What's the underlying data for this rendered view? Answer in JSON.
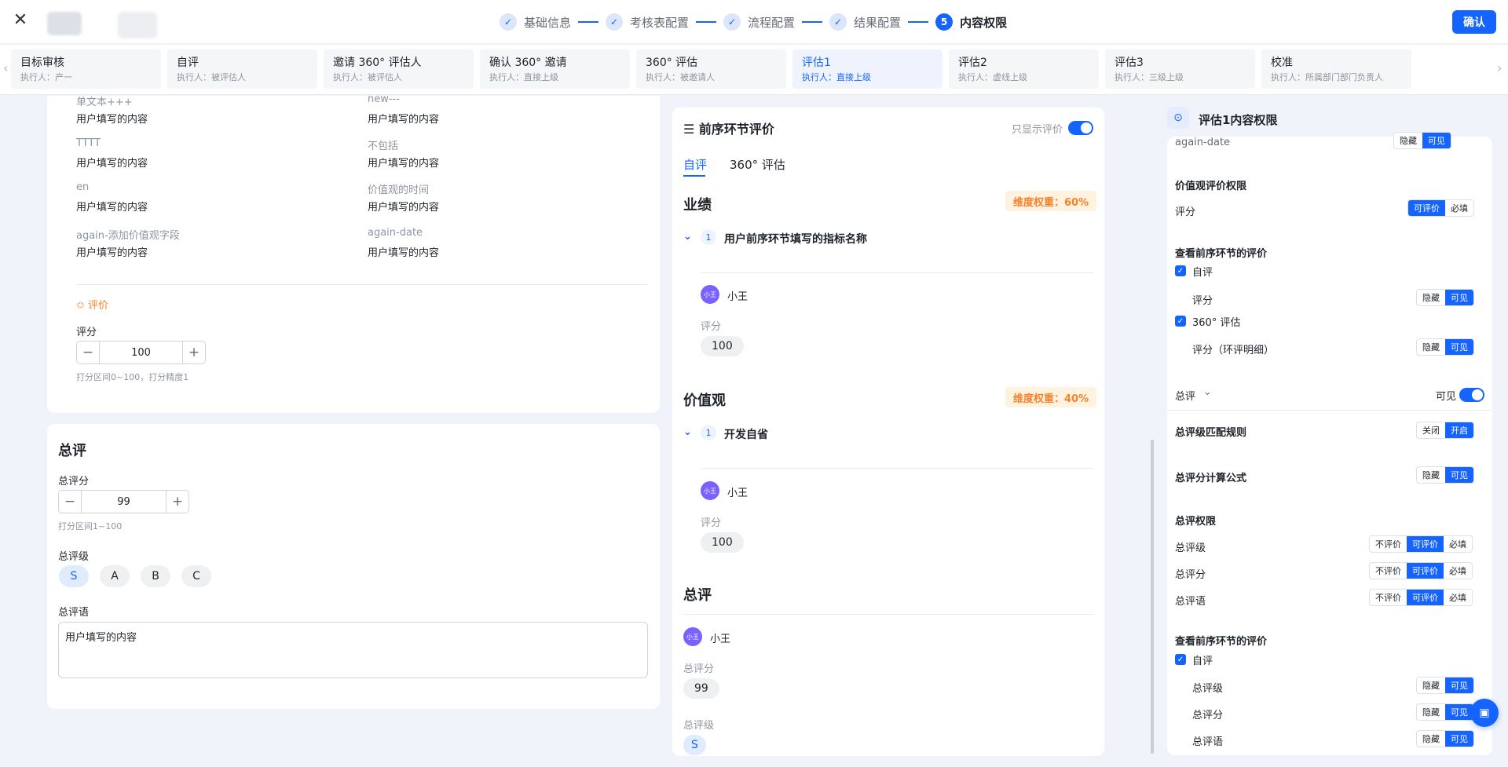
{
  "header": {
    "steps": [
      {
        "label": "基础信息",
        "state": "done"
      },
      {
        "label": "考核表配置",
        "state": "done"
      },
      {
        "label": "流程配置",
        "state": "done"
      },
      {
        "label": "结果配置",
        "state": "done"
      },
      {
        "label": "内容权限",
        "number": "5",
        "state": "current"
      }
    ],
    "confirm_label": "确认",
    "accent_color": "#1664ff"
  },
  "tabs": [
    {
      "title": "目标审核",
      "sub": "执行人：产一"
    },
    {
      "title": "自评",
      "sub": "执行人：被评估人"
    },
    {
      "title": "邀请 360° 评估人",
      "sub": "执行人：被评估人"
    },
    {
      "title": "确认 360° 邀请",
      "sub": "执行人：直接上级"
    },
    {
      "title": "360° 评估",
      "sub": "执行人：被邀请人"
    },
    {
      "title": "评估1",
      "sub": "执行人：直接上级",
      "active": true
    },
    {
      "title": "评估2",
      "sub": "执行人：虚线上级"
    },
    {
      "title": "评估3",
      "sub": "执行人：三级上级"
    },
    {
      "title": "校准",
      "sub": "执行人：所属部门部门负责人"
    }
  ],
  "left": {
    "fields": [
      {
        "label": "单文本+++",
        "value": "用户填写的内容"
      },
      {
        "label": "new---",
        "value": "用户填写的内容"
      },
      {
        "label": "TTTT",
        "value": "用户填写的内容"
      },
      {
        "label": "不包括",
        "value": "用户填写的内容"
      },
      {
        "label": "en",
        "value": "用户填写的内容"
      },
      {
        "label": "价值观的时间",
        "value": "用户填写的内容"
      },
      {
        "label": "again-添加价值观字段",
        "value": "用户填写的内容"
      },
      {
        "label": "again-date",
        "value": "用户填写的内容"
      }
    ],
    "eval_section": "评价",
    "score_label": "评分",
    "score_value": "100",
    "score_hint": "打分区间0~100，打分精度1",
    "overall": {
      "title": "总评",
      "total_score_label": "总评分",
      "total_score_value": "99",
      "total_score_hint": "打分区间1~100",
      "grade_label": "总评级",
      "grades": [
        "S",
        "A",
        "B",
        "C"
      ],
      "selected_grade": "S",
      "comment_label": "总评语",
      "comment_value": "用户填写的内容"
    }
  },
  "middle": {
    "title": "前序环节评价",
    "toggle_label": "只显示评价",
    "toggle_on": true,
    "tabs": [
      "自评",
      "360° 评估"
    ],
    "active_tab": "自评",
    "sections": [
      {
        "name": "业绩",
        "weight": "维度权重：60%",
        "item_num": "1",
        "item_name": "用户前序环节填写的指标名称",
        "user": "小王",
        "avatar_text": "小王",
        "score_label": "评分",
        "score": "100"
      },
      {
        "name": "价值观",
        "weight": "维度权重：40%",
        "item_num": "1",
        "item_name": "开发自省",
        "user": "小王",
        "avatar_text": "小王",
        "score_label": "评分",
        "score": "100"
      }
    ],
    "summary": {
      "title": "总评",
      "user": "小王",
      "avatar_text": "小王",
      "total_score_label": "总评分",
      "total_score": "99",
      "grade_label": "总评级",
      "grade": "S"
    }
  },
  "right": {
    "title": "评估1内容权限",
    "cut_row": {
      "label": "again-date",
      "opts": [
        "隐藏",
        "可见"
      ]
    },
    "values_perm": {
      "title": "价值观评价权限",
      "row_label": "评分",
      "opts": [
        "可评价",
        "必填"
      ]
    },
    "prev_view": {
      "title": "查看前序环节的评价",
      "items": [
        {
          "check": "自评",
          "row_label": "评分",
          "opts": [
            "隐藏",
            "可见"
          ]
        },
        {
          "check": "360° 评估",
          "row_label": "评分（环评明细）",
          "opts": [
            "隐藏",
            "可见"
          ]
        }
      ]
    },
    "overall": {
      "label": "总评",
      "visible_label": "可见",
      "visible_on": true,
      "match_rule": {
        "label": "总评级匹配规则",
        "opts": [
          "关闭",
          "开启"
        ]
      },
      "formula": {
        "label": "总评分计算公式",
        "opts": [
          "隐藏",
          "可见"
        ]
      },
      "perm_title": "总评权限",
      "perm_rows": [
        {
          "label": "总评级",
          "opts": [
            "不评价",
            "可评价",
            "必填"
          ]
        },
        {
          "label": "总评分",
          "opts": [
            "不评价",
            "可评价",
            "必填"
          ]
        },
        {
          "label": "总评语",
          "opts": [
            "不评价",
            "可评价",
            "必填"
          ]
        }
      ],
      "prev_title": "查看前序环节的评价",
      "prev_check": "自评",
      "prev_rows": [
        {
          "label": "总评级",
          "opts": [
            "隐藏",
            "可见"
          ]
        },
        {
          "label": "总评分",
          "opts": [
            "隐藏",
            "可见"
          ]
        },
        {
          "label": "总评语",
          "opts": [
            "隐藏",
            "可见"
          ]
        }
      ]
    }
  }
}
